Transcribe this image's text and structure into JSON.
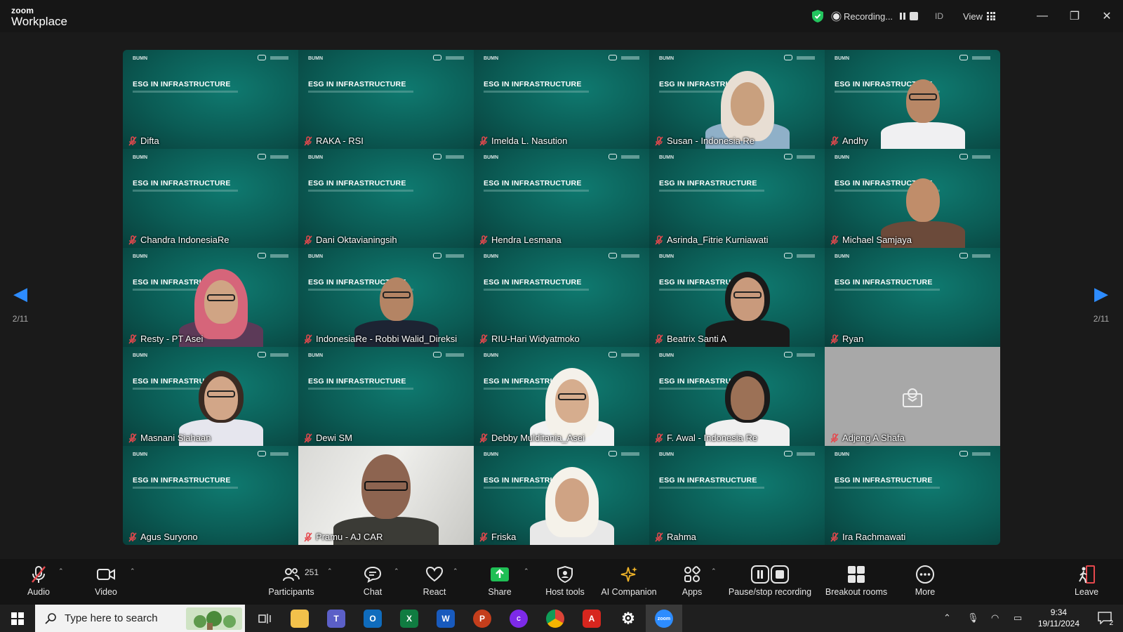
{
  "app": {
    "brand_top": "zoom",
    "brand_bottom": "Workplace"
  },
  "titlebar": {
    "recording": "Recording...",
    "lang": "ID",
    "view": "View",
    "minimize": "—",
    "restore": "❐",
    "close": "✕"
  },
  "slide": {
    "title": "ESG IN INFRASTRUCTURE"
  },
  "paging": {
    "left": "2/11",
    "right": "2/11"
  },
  "participants": [
    {
      "name": "Difta",
      "kind": "slide"
    },
    {
      "name": "RAKA - RSI",
      "kind": "slide"
    },
    {
      "name": "Imelda L. Nasution",
      "kind": "slide"
    },
    {
      "name": "Susan - Indonesia Re",
      "kind": "person"
    },
    {
      "name": "Andhy",
      "kind": "person"
    },
    {
      "name": "Chandra IndonesiaRe",
      "kind": "slide"
    },
    {
      "name": "Dani Oktavianingsih",
      "kind": "slide"
    },
    {
      "name": "Hendra Lesmana",
      "kind": "slide"
    },
    {
      "name": "Asrinda_Fitrie Kurniawati",
      "kind": "slide"
    },
    {
      "name": "Michael Samjaya",
      "kind": "person"
    },
    {
      "name": "Resty - PT Asei",
      "kind": "person"
    },
    {
      "name": "IndonesiaRe - Robbi Walid_Direksi",
      "kind": "person"
    },
    {
      "name": "RIU-Hari Widyatmoko",
      "kind": "slide"
    },
    {
      "name": "Beatrix Santi A",
      "kind": "person"
    },
    {
      "name": "Ryan",
      "kind": "slide"
    },
    {
      "name": "Masnani Siahaan",
      "kind": "person"
    },
    {
      "name": "Dewi SM",
      "kind": "slide"
    },
    {
      "name": "Debby Mulditania_Asei",
      "kind": "person"
    },
    {
      "name": "F. Awal - Indonesia Re",
      "kind": "person"
    },
    {
      "name": "Adjeng A Shafa",
      "kind": "gray"
    },
    {
      "name": "Agus Suryono",
      "kind": "slide"
    },
    {
      "name": "Pramu - AJ CAR",
      "kind": "photo"
    },
    {
      "name": "Friska",
      "kind": "person"
    },
    {
      "name": "Rahma",
      "kind": "slide"
    },
    {
      "name": "Ira Rachmawati",
      "kind": "slide"
    }
  ],
  "toolbar": {
    "audio": "Audio",
    "video": "Video",
    "participants": "Participants",
    "participants_count": "251",
    "chat": "Chat",
    "react": "React",
    "share": "Share",
    "host_tools": "Host tools",
    "ai_companion": "AI Companion",
    "apps": "Apps",
    "pause_stop": "Pause/stop recording",
    "breakout": "Breakout rooms",
    "more": "More",
    "leave": "Leave"
  },
  "taskbar": {
    "search_placeholder": "Type here to search",
    "time": "9:34",
    "date": "19/11/2024",
    "notif_count": "2"
  },
  "colors": {
    "tile_bg": "#0b5c55",
    "accent": "#2d8cff",
    "share_green": "#1fbf55",
    "leave_red": "#e5484d"
  }
}
